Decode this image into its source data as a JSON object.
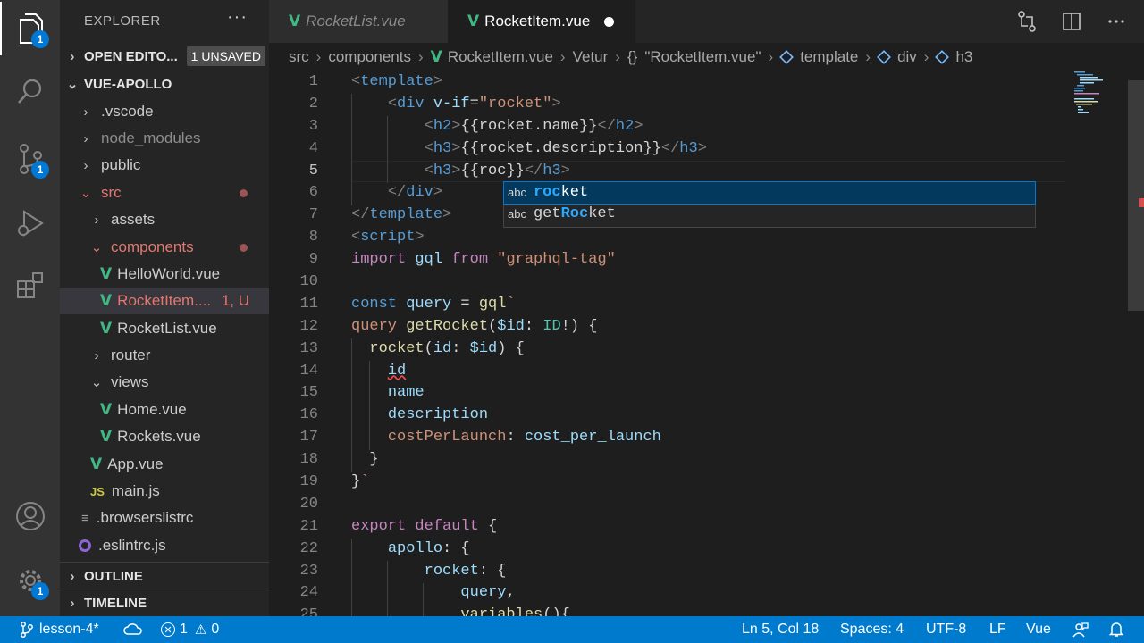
{
  "activity_bar": {
    "explorer_badge": "1",
    "scm_badge": "1",
    "manage_badge": "1"
  },
  "sidebar": {
    "title": "EXPLORER",
    "more": "···",
    "open_editors": {
      "label": "OPEN EDITO...",
      "badge": "1 UNSAVED"
    },
    "project": "VUE-APOLLO",
    "tree": {
      "vscode": ".vscode",
      "node_modules": "node_modules",
      "public": "public",
      "src": "src",
      "assets": "assets",
      "components": "components",
      "helloworld": "HelloWorld.vue",
      "rocketitem": "RocketItem....",
      "rocketitem_status": "1, U",
      "rocketlist": "RocketList.vue",
      "router": "router",
      "views": "views",
      "home": "Home.vue",
      "rockets": "Rockets.vue",
      "app": "App.vue",
      "main": "main.js",
      "browserslist": ".browserslistrc",
      "eslint": ".eslintrc.js"
    },
    "outline": "OUTLINE",
    "timeline": "TIMELINE"
  },
  "tabs": [
    {
      "label": "RocketList.vue"
    },
    {
      "label": "RocketItem.vue"
    }
  ],
  "breadcrumb": {
    "src": "src",
    "components": "components",
    "file": "RocketItem.vue",
    "vetur": "Vetur",
    "braces": "{}",
    "obj": "\"RocketItem.vue\"",
    "template": "template",
    "div": "div",
    "h3": "h3"
  },
  "editor": {
    "line_numbers": [
      "1",
      "2",
      "3",
      "4",
      "5",
      "6",
      "7",
      "8",
      "9",
      "10",
      "11",
      "12",
      "13",
      "14",
      "15",
      "16",
      "17",
      "18",
      "19",
      "20",
      "21",
      "22",
      "23",
      "24",
      "25"
    ]
  },
  "suggest": {
    "items": [
      {
        "kind": "abc",
        "match": "roc",
        "prefix": "",
        "rest": "ket"
      },
      {
        "kind": "abc",
        "prefix": "get",
        "match": "Roc",
        "rest": "ket"
      }
    ]
  },
  "statusbar": {
    "branch": "lesson-4*",
    "errors": "1",
    "warnings": "0",
    "position": "Ln 5, Col 18",
    "spaces": "Spaces: 4",
    "encoding": "UTF-8",
    "eol": "LF",
    "language": "Vue"
  }
}
